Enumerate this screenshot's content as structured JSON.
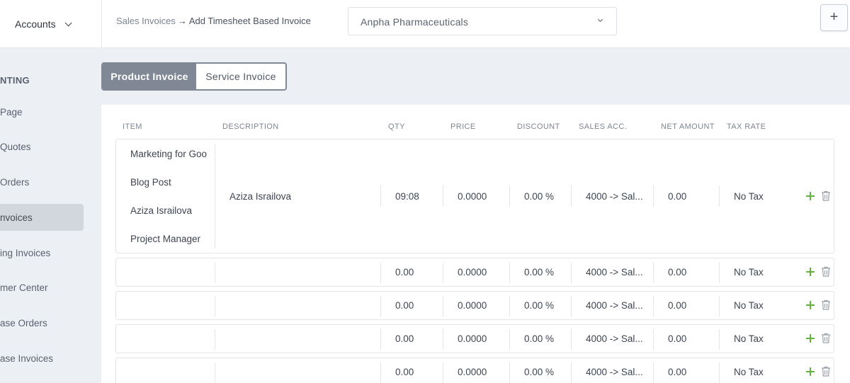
{
  "header": {
    "app_name": "Accounts",
    "breadcrumb_parent": "Sales Invoices",
    "breadcrumb_arrow": "→",
    "breadcrumb_current": "Add Timesheet Based Invoice",
    "customer_selected": "Anpha Pharmaceuticals",
    "add_label": "+"
  },
  "sidebar": {
    "section": "NTING",
    "items": [
      {
        "label": "Page"
      },
      {
        "label": "Quotes"
      },
      {
        "label": "Orders"
      },
      {
        "label": "nvoices"
      },
      {
        "label": "ing Invoices"
      },
      {
        "label": "mer Center"
      },
      {
        "label": "ase Orders"
      },
      {
        "label": "ase Invoices"
      }
    ]
  },
  "invoice_type": {
    "options": [
      "Product Invoice",
      "Service Invoice"
    ],
    "selected": "Product Invoice"
  },
  "table": {
    "columns": [
      "ITEM",
      "DESCRIPTION",
      "QTY",
      "PRICE",
      "DISCOUNT",
      "SALES ACC.",
      "NET AMOUNT",
      "TAX RATE"
    ],
    "first_row": {
      "item_options": [
        "Marketing for Goo",
        "Blog Post",
        "Aziza Israilova",
        "Project Manager"
      ],
      "description": "Aziza Israilova",
      "qty": "09:08",
      "price": "0.0000",
      "discount": "0.00 %",
      "sales_acc": "4000 -> Sal...",
      "net_amount": "0.00",
      "tax_rate": "No Tax"
    },
    "rows": [
      {
        "qty": "0.00",
        "price": "0.0000",
        "discount": "0.00 %",
        "sales_acc": "4000 -> Sal...",
        "net_amount": "0.00",
        "tax_rate": "No Tax"
      },
      {
        "qty": "0.00",
        "price": "0.0000",
        "discount": "0.00 %",
        "sales_acc": "4000 -> Sal...",
        "net_amount": "0.00",
        "tax_rate": "No Tax"
      },
      {
        "qty": "0.00",
        "price": "0.0000",
        "discount": "0.00 %",
        "sales_acc": "4000 -> Sal...",
        "net_amount": "0.00",
        "tax_rate": "No Tax"
      },
      {
        "qty": "0.00",
        "price": "0.0000",
        "discount": "0.00 %",
        "sales_acc": "4000 -> Sal...",
        "net_amount": "0.00",
        "tax_rate": "No Tax"
      }
    ]
  },
  "colors": {
    "accent_plus": "#64b33e",
    "toggle_active": "#7f8894",
    "sidebar_active": "#d2d7de"
  },
  "icons": {
    "add_row": "plus-icon",
    "delete_row": "trash-icon",
    "dropdown": "chevron-down-icon"
  }
}
